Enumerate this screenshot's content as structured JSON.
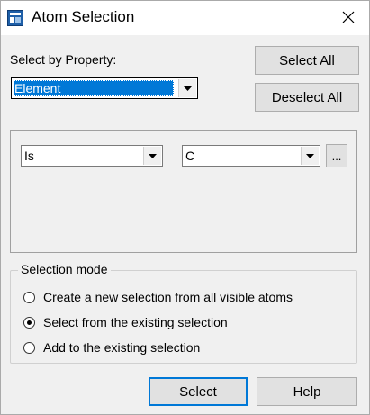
{
  "window": {
    "title": "Atom Selection",
    "close_icon": "close-icon",
    "app_icon": "app-icon"
  },
  "property": {
    "label": "Select by Property:",
    "selected_value": "Element"
  },
  "buttons": {
    "select_all": "Select All",
    "deselect_all": "Deselect All",
    "ellipsis": "...",
    "select": "Select",
    "help": "Help"
  },
  "criteria": {
    "operator_value": "Is",
    "element_value": "C"
  },
  "selection_mode": {
    "legend": "Selection mode",
    "options": [
      {
        "label": "Create a new selection from all visible atoms",
        "checked": false
      },
      {
        "label": "Select from the existing selection",
        "checked": true
      },
      {
        "label": "Add to the existing selection",
        "checked": false
      }
    ]
  },
  "colors": {
    "accent": "#0078d7",
    "dialog_bg": "#f0f0f0"
  }
}
